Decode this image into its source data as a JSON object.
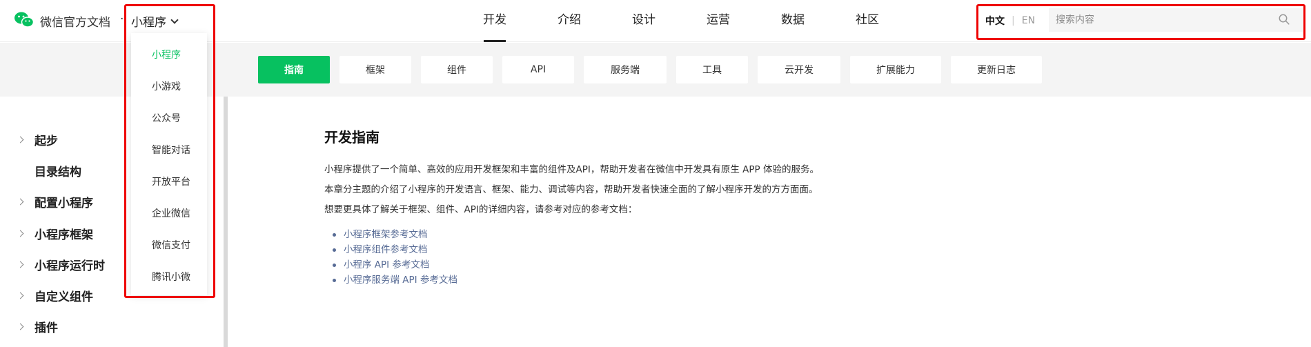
{
  "header": {
    "brand": "微信官方文档",
    "separator": "·",
    "product_selector": "小程序",
    "nav": [
      "开发",
      "介绍",
      "设计",
      "运营",
      "数据",
      "社区"
    ],
    "active_nav": "开发",
    "lang_zh": "中文",
    "lang_en": "EN",
    "search_placeholder": "搜索内容"
  },
  "dropdown": {
    "items": [
      "小程序",
      "小游戏",
      "公众号",
      "智能对话",
      "开放平台",
      "企业微信",
      "微信支付",
      "腾讯小微"
    ],
    "active": "小程序"
  },
  "subnav": {
    "tabs": [
      "指南",
      "框架",
      "组件",
      "API",
      "服务端",
      "工具",
      "云开发",
      "扩展能力",
      "更新日志"
    ],
    "active": "指南"
  },
  "sidebar": {
    "items": [
      {
        "label": "起步",
        "expandable": true
      },
      {
        "label": "目录结构",
        "expandable": false
      },
      {
        "label": "配置小程序",
        "expandable": true
      },
      {
        "label": "小程序框架",
        "expandable": true
      },
      {
        "label": "小程序运行时",
        "expandable": true
      },
      {
        "label": "自定义组件",
        "expandable": true
      },
      {
        "label": "插件",
        "expandable": true
      }
    ]
  },
  "content": {
    "title": "开发指南",
    "paragraphs": [
      "小程序提供了一个简单、高效的应用开发框架和丰富的组件及API，帮助开发者在微信中开发具有原生 APP 体验的服务。",
      "本章分主题的介绍了小程序的开发语言、框架、能力、调试等内容，帮助开发者快速全面的了解小程序开发的方方面面。",
      "想要更具体了解关于框架、组件、API的详细内容，请参考对应的参考文档："
    ],
    "links": [
      "小程序框架参考文档",
      "小程序组件参考文档",
      "小程序 API 参考文档",
      "小程序服务端 API 参考文档"
    ]
  },
  "colors": {
    "accent": "#07c160",
    "link": "#576b95",
    "highlight_box": "#e00000"
  },
  "icons": [
    "wechat-logo-icon",
    "chevron-down-icon",
    "search-icon",
    "chevron-right-icon"
  ]
}
